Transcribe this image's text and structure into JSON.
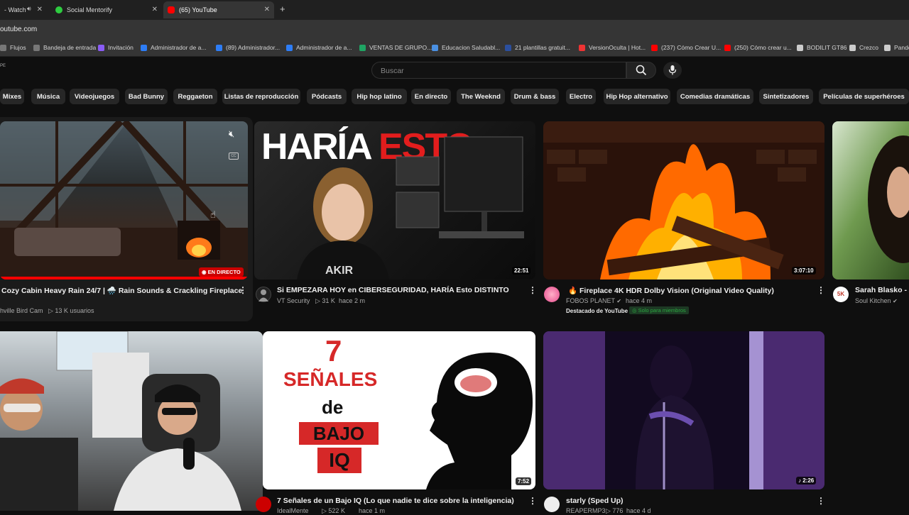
{
  "browser": {
    "tabs": [
      {
        "title": "- Watch",
        "fav": "#3a6ea5"
      },
      {
        "title": "Social Mentorify",
        "fav": "#2ecc40"
      },
      {
        "title": "(65) YouTube",
        "fav": "#ff0000"
      }
    ],
    "new_tab": "+",
    "url": "outube.com",
    "bookmarks": [
      {
        "label": "Flujos",
        "color": "#777"
      },
      {
        "label": "Bandeja de entrada",
        "color": "#777"
      },
      {
        "label": "Invitación",
        "color": "#8a5cf6"
      },
      {
        "label": "Administrador de a...",
        "color": "#2d7df6"
      },
      {
        "label": "(89) Administrador...",
        "color": "#2d7df6"
      },
      {
        "label": "Administrador de a...",
        "color": "#2d7df6"
      },
      {
        "label": "VENTAS DE GRUPO...",
        "color": "#1fa463"
      },
      {
        "label": "Educacion Saludabl...",
        "color": "#4a90e2"
      },
      {
        "label": "21 plantillas gratuit...",
        "color": "#2b4f9e"
      },
      {
        "label": "VersionOculta | Hot...",
        "color": "#e33"
      },
      {
        "label": "(237) Cómo Crear U...",
        "color": "#f00"
      },
      {
        "label": "(250) Cómo crear u...",
        "color": "#f00"
      },
      {
        "label": "BODILIT GT86",
        "color": "#ccc"
      },
      {
        "label": "Crezco",
        "color": "#ccc"
      },
      {
        "label": "Pande",
        "color": "#ccc"
      }
    ]
  },
  "header": {
    "country_code": "PE",
    "search_placeholder": "Buscar"
  },
  "chips": [
    "Mixes",
    "Música",
    "Videojuegos",
    "Bad Bunny",
    "Reggaeton",
    "Listas de reproducción",
    "Pódcasts",
    "Hip hop latino",
    "En directo",
    "The Weeknd",
    "Drum & bass",
    "Electro",
    "Hip Hop alternativo",
    "Comedias dramáticas",
    "Sintetizadores",
    "Películas de superhéroes"
  ],
  "videos": {
    "v1": {
      "title": "Cozy Cabin Heavy Rain 24/7 | 🌧️ Rain Sounds & Crackling Fireplace",
      "channel": "hville Bird Cam",
      "views": "▷ 13 K usuarios",
      "badge": "EN DIRECTO"
    },
    "v2": {
      "title": "Si EMPEZARA HOY en CIBERSEGURIDAD, HARÍA Esto DISTINTO",
      "channel": "VT Security",
      "views": "▷ 31 K",
      "age": "hace 2 m",
      "duration": "22:51",
      "thumb_text_a": "HARÍA",
      "thumb_text_b": "ESTO"
    },
    "v3": {
      "title": "🔥 Fireplace 4K HDR Dolby Vision (Original Video Quality)",
      "channel": "FOBOS PLANET",
      "views": "▷ 3 K",
      "age": "hace 4 m",
      "duration": "3:07:10",
      "featured": "Destacado de YouTube",
      "members": "Solo para miembros"
    },
    "v4": {
      "title": "Sarah Blasko - A",
      "channel": "Soul Kitchen",
      "avatar_text": "5K"
    },
    "v5": {},
    "v6": {
      "title": "7 Señales de un Bajo IQ (Lo que nadie te dice sobre la inteligencia)",
      "channel": "IdealMente",
      "views": "▷ 522 K",
      "age": "hace 1 m",
      "duration": "7:52",
      "thumb_num": "7",
      "thumb_l1": "SEÑALES",
      "thumb_l2": "de",
      "thumb_l3": "BAJO",
      "thumb_l4": "IQ"
    },
    "v7": {
      "title": "starly (Sped Up)",
      "channel": "REAPERMP3",
      "views": "▷ 776",
      "age": "hace 4 d",
      "duration": "♪ 2:26"
    }
  },
  "colors": {
    "accent": "#ff0000",
    "bg": "#0f0f0f",
    "chip": "#272727",
    "member_green": "#2ba640"
  }
}
